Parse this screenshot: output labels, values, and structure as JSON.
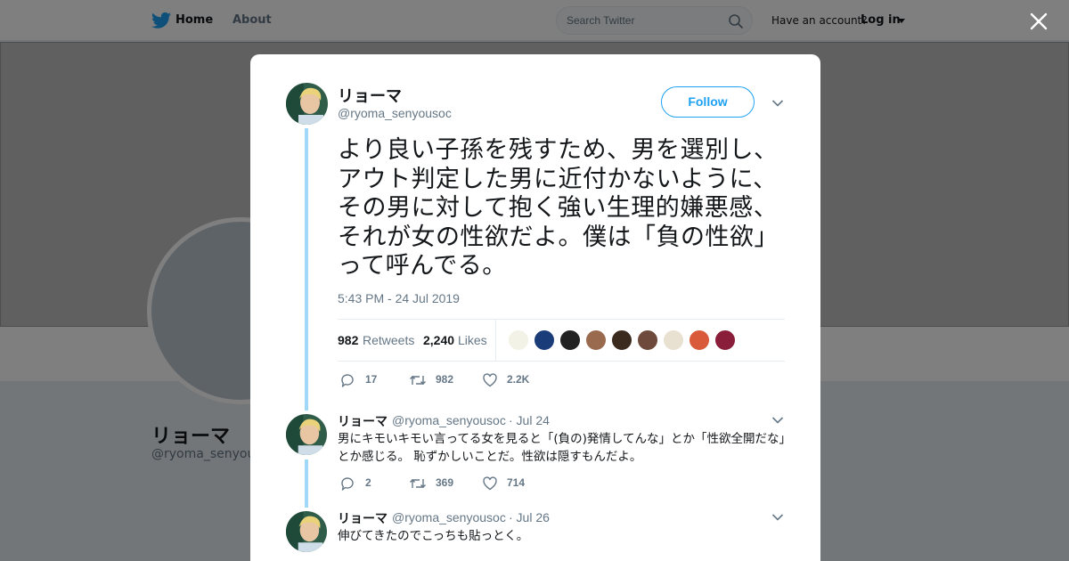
{
  "colors": {
    "accent": "#1da1f2",
    "thread_line": "#a0d8f7",
    "text_primary": "#14171a",
    "text_secondary": "#657786"
  },
  "nav": {
    "logo_icon": "twitter-bird-icon",
    "home_label": "Home",
    "about_label": "About",
    "search_placeholder": "Search Twitter",
    "search_icon": "search-icon",
    "have_account": "Have an account?",
    "login_label": "Log in"
  },
  "profile": {
    "name": "リョーマ",
    "handle": "@ryoma_senyousoc"
  },
  "tweet": {
    "author_name": "リョーマ",
    "author_handle": "@ryoma_senyousoc",
    "follow_label": "Follow",
    "text": "より良い子孫を残すため、男を選別し、アウト判定した男に近付かないように、その男に対して抱く強い生理的嫌悪感、それが女の性欲だよ。僕は「負の性欲」って呼んでる。",
    "timestamp": "5:43 PM - 24 Jul 2019",
    "retweets_count": "982",
    "retweets_label": "Retweets",
    "likes_count": "2,240",
    "likes_label": "Likes",
    "likers": [
      "liker-1",
      "liker-2",
      "liker-3",
      "liker-4",
      "liker-5",
      "liker-6",
      "liker-7",
      "liker-8",
      "liker-9"
    ],
    "reply_count": "17",
    "retweet_count": "982",
    "like_count": "2.2K"
  },
  "replies": [
    {
      "name": "リョーマ",
      "handle": "@ryoma_senyousoc",
      "date": "· Jul 24",
      "text": "男にキモいキモい言ってる女を見ると「(負の)発情してんな」とか「性欲全開だな」とか感じる。 恥ずかしいことだ。性欲は隠すもんだよ。",
      "reply_count": "2",
      "retweet_count": "369",
      "like_count": "714"
    },
    {
      "name": "リョーマ",
      "handle": "@ryoma_senyousoc",
      "date": "· Jul 26",
      "text": "伸びてきたのでこっちも貼っとく。"
    }
  ]
}
